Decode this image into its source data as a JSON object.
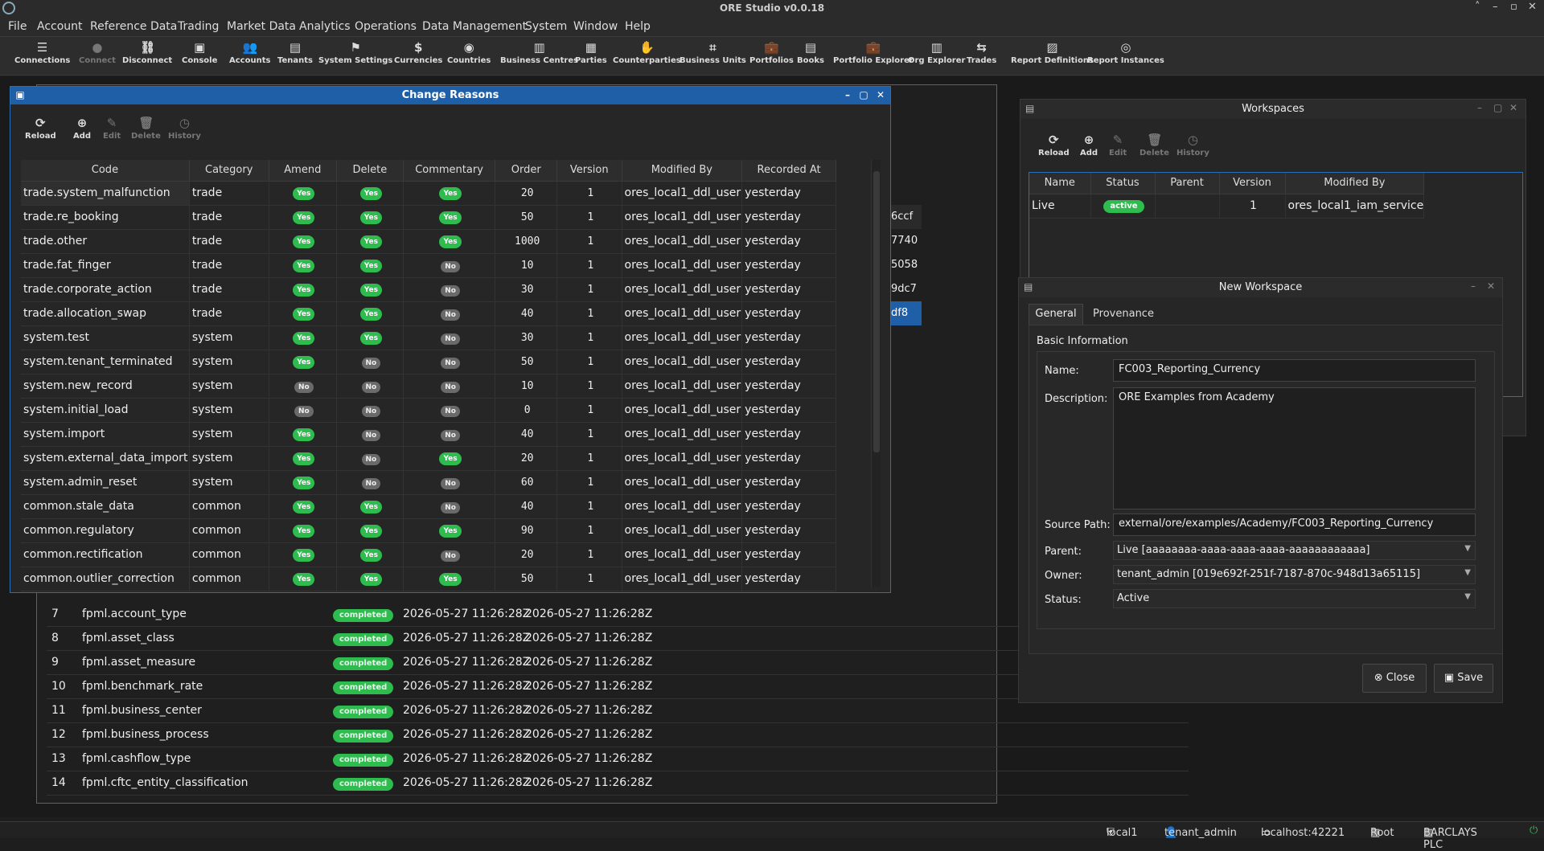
{
  "app": {
    "title": "ORE Studio v0.0.18"
  },
  "menu": [
    "File",
    "Account",
    "Reference Data",
    "Trading",
    "Market Data",
    "Analytics",
    "Operations",
    "Data Management",
    "System",
    "Window",
    "Help"
  ],
  "toolbar": [
    {
      "label": "Connections",
      "icon": "connections-icon",
      "enabled": true
    },
    {
      "label": "Connect",
      "icon": "connect-icon",
      "enabled": false
    },
    {
      "label": "Disconnect",
      "icon": "disconnect-icon",
      "enabled": true
    },
    {
      "label": "Console",
      "icon": "console-icon",
      "enabled": true
    },
    {
      "label": "Accounts",
      "icon": "accounts-icon",
      "enabled": true
    },
    {
      "label": "Tenants",
      "icon": "tenants-icon",
      "enabled": true
    },
    {
      "label": "System Settings",
      "icon": "flag-icon",
      "enabled": true
    },
    {
      "label": "Currencies",
      "icon": "currency-icon",
      "enabled": true
    },
    {
      "label": "Countries",
      "icon": "globe-icon",
      "enabled": true
    },
    {
      "label": "Business Centres",
      "icon": "building-icon",
      "enabled": true
    },
    {
      "label": "Parties",
      "icon": "parties-icon",
      "enabled": true
    },
    {
      "label": "Counterparties",
      "icon": "handshake-icon",
      "enabled": true
    },
    {
      "label": "Business Units",
      "icon": "org-icon",
      "enabled": true
    },
    {
      "label": "Portfolios",
      "icon": "briefcase-icon",
      "enabled": true
    },
    {
      "label": "Books",
      "icon": "book-icon",
      "enabled": true
    },
    {
      "label": "Portfolio Explorer",
      "icon": "briefcase-icon",
      "enabled": true
    },
    {
      "label": "Org Explorer",
      "icon": "building-icon",
      "enabled": true
    },
    {
      "label": "Trades",
      "icon": "trades-icon",
      "enabled": true
    },
    {
      "label": "Report Definitions",
      "icon": "report-icon",
      "enabled": true
    },
    {
      "label": "Report Instances",
      "icon": "report-instances-icon",
      "enabled": true
    }
  ],
  "change_reasons": {
    "title": "Change Reasons",
    "actions": [
      {
        "label": "Reload",
        "enabled": true
      },
      {
        "label": "Add",
        "enabled": true
      },
      {
        "label": "Edit",
        "enabled": false
      },
      {
        "label": "Delete",
        "enabled": false
      },
      {
        "label": "History",
        "enabled": false
      }
    ],
    "columns": [
      "Code",
      "Category",
      "Amend",
      "Delete",
      "Commentary",
      "Order",
      "Version",
      "Modified By",
      "Recorded At"
    ],
    "rows": [
      [
        "trade.system_malfunction",
        "trade",
        "Yes",
        "Yes",
        "Yes",
        "20",
        "1",
        "ores_local1_ddl_user",
        "yesterday"
      ],
      [
        "trade.re_booking",
        "trade",
        "Yes",
        "Yes",
        "Yes",
        "50",
        "1",
        "ores_local1_ddl_user",
        "yesterday"
      ],
      [
        "trade.other",
        "trade",
        "Yes",
        "Yes",
        "Yes",
        "1000",
        "1",
        "ores_local1_ddl_user",
        "yesterday"
      ],
      [
        "trade.fat_finger",
        "trade",
        "Yes",
        "Yes",
        "No",
        "10",
        "1",
        "ores_local1_ddl_user",
        "yesterday"
      ],
      [
        "trade.corporate_action",
        "trade",
        "Yes",
        "Yes",
        "No",
        "30",
        "1",
        "ores_local1_ddl_user",
        "yesterday"
      ],
      [
        "trade.allocation_swap",
        "trade",
        "Yes",
        "Yes",
        "No",
        "40",
        "1",
        "ores_local1_ddl_user",
        "yesterday"
      ],
      [
        "system.test",
        "system",
        "Yes",
        "Yes",
        "No",
        "30",
        "1",
        "ores_local1_ddl_user",
        "yesterday"
      ],
      [
        "system.tenant_terminated",
        "system",
        "Yes",
        "No",
        "No",
        "50",
        "1",
        "ores_local1_ddl_user",
        "yesterday"
      ],
      [
        "system.new_record",
        "system",
        "No",
        "No",
        "No",
        "10",
        "1",
        "ores_local1_ddl_user",
        "yesterday"
      ],
      [
        "system.initial_load",
        "system",
        "No",
        "No",
        "No",
        "0",
        "1",
        "ores_local1_ddl_user",
        "yesterday"
      ],
      [
        "system.import",
        "system",
        "Yes",
        "No",
        "No",
        "40",
        "1",
        "ores_local1_ddl_user",
        "yesterday"
      ],
      [
        "system.external_data_import",
        "system",
        "Yes",
        "No",
        "Yes",
        "20",
        "1",
        "ores_local1_ddl_user",
        "yesterday"
      ],
      [
        "system.admin_reset",
        "system",
        "Yes",
        "No",
        "No",
        "60",
        "1",
        "ores_local1_ddl_user",
        "yesterday"
      ],
      [
        "common.stale_data",
        "common",
        "Yes",
        "Yes",
        "No",
        "40",
        "1",
        "ores_local1_ddl_user",
        "yesterday"
      ],
      [
        "common.regulatory",
        "common",
        "Yes",
        "Yes",
        "Yes",
        "90",
        "1",
        "ores_local1_ddl_user",
        "yesterday"
      ],
      [
        "common.rectification",
        "common",
        "Yes",
        "Yes",
        "No",
        "20",
        "1",
        "ores_local1_ddl_user",
        "yesterday"
      ],
      [
        "common.outlier_correction",
        "common",
        "Yes",
        "Yes",
        "Yes",
        "50",
        "1",
        "ores_local1_ddl_user",
        "yesterday"
      ]
    ]
  },
  "background_peek": [
    "6ccf",
    "7740",
    "5058",
    "9dc7",
    "df8"
  ],
  "background_rows": [
    [
      "7",
      "fpml.account_type",
      "completed",
      "2026-05-27 11:26:28Z",
      "2026-05-27 11:26:28Z"
    ],
    [
      "8",
      "fpml.asset_class",
      "completed",
      "2026-05-27 11:26:28Z",
      "2026-05-27 11:26:28Z"
    ],
    [
      "9",
      "fpml.asset_measure",
      "completed",
      "2026-05-27 11:26:28Z",
      "2026-05-27 11:26:28Z"
    ],
    [
      "10",
      "fpml.benchmark_rate",
      "completed",
      "2026-05-27 11:26:28Z",
      "2026-05-27 11:26:28Z"
    ],
    [
      "11",
      "fpml.business_center",
      "completed",
      "2026-05-27 11:26:28Z",
      "2026-05-27 11:26:28Z"
    ],
    [
      "12",
      "fpml.business_process",
      "completed",
      "2026-05-27 11:26:28Z",
      "2026-05-27 11:26:28Z"
    ],
    [
      "13",
      "fpml.cashflow_type",
      "completed",
      "2026-05-27 11:26:28Z",
      "2026-05-27 11:26:28Z"
    ],
    [
      "14",
      "fpml.cftc_entity_classification",
      "completed",
      "2026-05-27 11:26:28Z",
      "2026-05-27 11:26:28Z"
    ]
  ],
  "workspaces": {
    "title": "Workspaces",
    "actions": [
      {
        "label": "Reload",
        "enabled": true
      },
      {
        "label": "Add",
        "enabled": true
      },
      {
        "label": "Edit",
        "enabled": false
      },
      {
        "label": "Delete",
        "enabled": false
      },
      {
        "label": "History",
        "enabled": false
      }
    ],
    "columns": [
      "Name",
      "Status",
      "Parent",
      "Version",
      "Modified By"
    ],
    "rows": [
      [
        "Live",
        "active",
        "",
        "1",
        "ores_local1_iam_service"
      ]
    ]
  },
  "new_workspace": {
    "title": "New Workspace",
    "tabs": [
      "General",
      "Provenance"
    ],
    "section": "Basic Information",
    "name_label": "Name:",
    "name_value": "FC003_Reporting_Currency",
    "description_label": "Description:",
    "description_value": "ORE Examples from Academy",
    "source_label": "Source Path:",
    "source_value": "external/ore/examples/Academy/FC003_Reporting_Currency",
    "parent_label": "Parent:",
    "parent_value": "Live [aaaaaaaa-aaaa-aaaa-aaaa-aaaaaaaaaaaa]",
    "owner_label": "Owner:",
    "owner_value": "tenant_admin [019e692f-251f-7187-870c-948d13a65115]",
    "status_label": "Status:",
    "status_value": "Active",
    "close_label": "Close",
    "save_label": "Save"
  },
  "status": {
    "env": "local1",
    "user": "tenant_admin",
    "host": "localhost:42221",
    "scope": "Root",
    "party": "BARCLAYS PLC"
  },
  "colors": {
    "accent": "#1f5fa8",
    "yes": "#2ebc4f",
    "no": "#6a6a6a"
  }
}
